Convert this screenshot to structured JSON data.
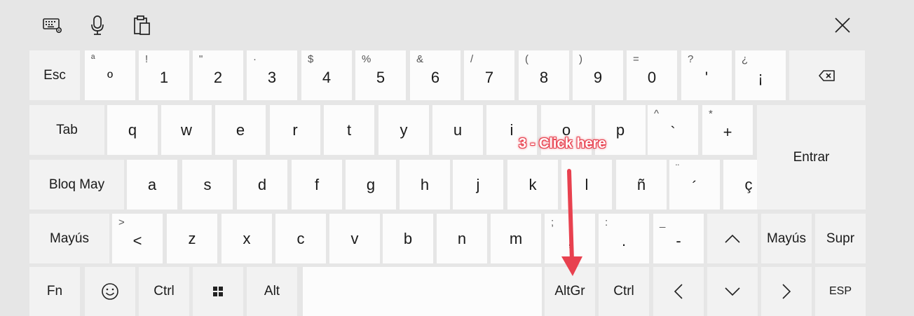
{
  "toolbar": {
    "icons": [
      "keyboard-settings-icon",
      "microphone-icon",
      "clipboard-icon"
    ],
    "close_icon": "close-icon"
  },
  "row1": [
    {
      "id": "esc",
      "label": "Esc"
    },
    {
      "id": "ordinal",
      "main": "º",
      "sec": "ª"
    },
    {
      "id": "1",
      "main": "1",
      "sec": "!"
    },
    {
      "id": "2",
      "main": "2",
      "sec": "\""
    },
    {
      "id": "3",
      "main": "3",
      "sec": "·"
    },
    {
      "id": "4",
      "main": "4",
      "sec": "$"
    },
    {
      "id": "5",
      "main": "5",
      "sec": "%"
    },
    {
      "id": "6",
      "main": "6",
      "sec": "&"
    },
    {
      "id": "7",
      "main": "7",
      "sec": "/"
    },
    {
      "id": "8",
      "main": "8",
      "sec": "("
    },
    {
      "id": "9",
      "main": "9",
      "sec": ")"
    },
    {
      "id": "0",
      "main": "0",
      "sec": "="
    },
    {
      "id": "apostrophe",
      "main": "'",
      "sec": "?"
    },
    {
      "id": "exclamation",
      "main": "¡",
      "sec": "¿"
    },
    {
      "id": "backspace",
      "icon": "backspace-icon"
    }
  ],
  "row2": [
    {
      "id": "tab",
      "label": "Tab"
    },
    {
      "id": "q",
      "main": "q"
    },
    {
      "id": "w",
      "main": "w"
    },
    {
      "id": "e",
      "main": "e"
    },
    {
      "id": "r",
      "main": "r"
    },
    {
      "id": "t",
      "main": "t"
    },
    {
      "id": "y",
      "main": "y"
    },
    {
      "id": "u",
      "main": "u"
    },
    {
      "id": "i",
      "main": "i"
    },
    {
      "id": "o",
      "main": "o"
    },
    {
      "id": "p",
      "main": "p"
    },
    {
      "id": "grave",
      "main": "`",
      "sec": "^"
    },
    {
      "id": "plus",
      "main": "+",
      "sec": "*"
    }
  ],
  "enter_label": "Entrar",
  "row3": [
    {
      "id": "capslock",
      "label": "Bloq May"
    },
    {
      "id": "a",
      "main": "a"
    },
    {
      "id": "s",
      "main": "s"
    },
    {
      "id": "d",
      "main": "d"
    },
    {
      "id": "f",
      "main": "f"
    },
    {
      "id": "g",
      "main": "g"
    },
    {
      "id": "h",
      "main": "h"
    },
    {
      "id": "j",
      "main": "j"
    },
    {
      "id": "k",
      "main": "k"
    },
    {
      "id": "l",
      "main": "l"
    },
    {
      "id": "enye",
      "main": "ñ"
    },
    {
      "id": "acute",
      "main": "´",
      "sec": "¨"
    },
    {
      "id": "cedilla",
      "main": "ç"
    }
  ],
  "row4": [
    {
      "id": "shift-left",
      "label": "Mayús"
    },
    {
      "id": "less",
      "main": "<",
      "sec": ">"
    },
    {
      "id": "z",
      "main": "z"
    },
    {
      "id": "x",
      "main": "x"
    },
    {
      "id": "c",
      "main": "c"
    },
    {
      "id": "v",
      "main": "v"
    },
    {
      "id": "b",
      "main": "b"
    },
    {
      "id": "n",
      "main": "n"
    },
    {
      "id": "m",
      "main": "m"
    },
    {
      "id": "comma",
      "main": ",",
      "sec": ";"
    },
    {
      "id": "period",
      "main": ".",
      "sec": ":"
    },
    {
      "id": "minus",
      "main": "-",
      "sec": "_"
    },
    {
      "id": "up",
      "icon": "arrow-up-icon"
    },
    {
      "id": "shift-right",
      "label": "Mayús"
    },
    {
      "id": "delete",
      "label": "Supr"
    }
  ],
  "row5": [
    {
      "id": "fn",
      "label": "Fn"
    },
    {
      "id": "emoji",
      "icon": "emoji-icon"
    },
    {
      "id": "ctrl-left",
      "label": "Ctrl"
    },
    {
      "id": "windows",
      "icon": "windows-icon"
    },
    {
      "id": "alt",
      "label": "Alt"
    },
    {
      "id": "space",
      "label": ""
    },
    {
      "id": "altgr",
      "label": "AltGr"
    },
    {
      "id": "ctrl-right",
      "label": "Ctrl"
    },
    {
      "id": "left",
      "icon": "arrow-left-icon"
    },
    {
      "id": "down",
      "icon": "arrow-down-icon"
    },
    {
      "id": "right",
      "icon": "arrow-right-icon"
    },
    {
      "id": "language",
      "label": "ESP",
      "small": true
    }
  ],
  "annotation": {
    "text": "3 - Click here",
    "color": "#e8414f"
  }
}
